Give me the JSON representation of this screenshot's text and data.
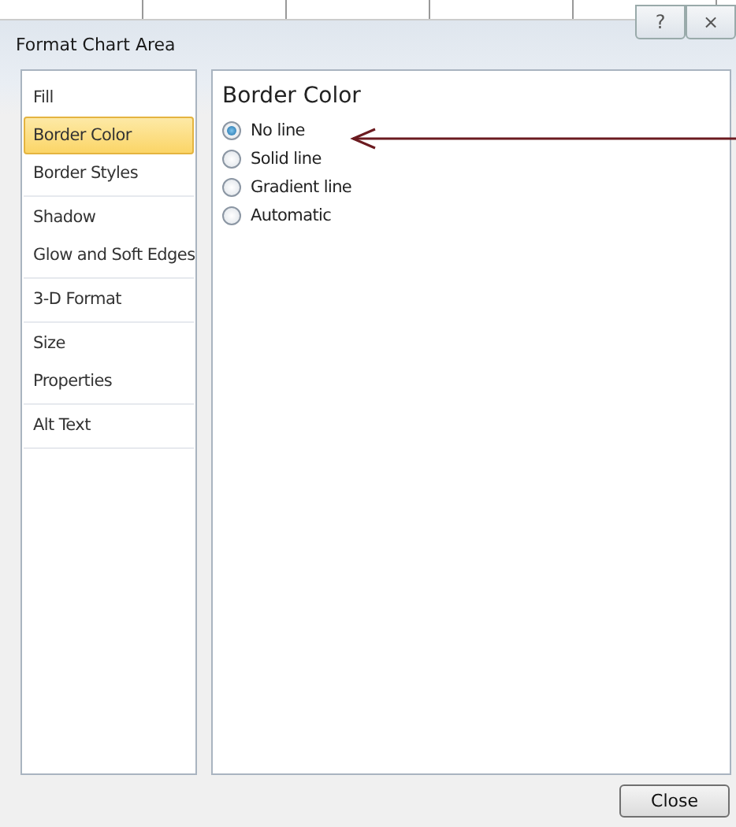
{
  "window": {
    "title": "Format Chart Area",
    "help_button": "?",
    "close_glyph": "×"
  },
  "sidebar": {
    "groups": [
      {
        "items": [
          {
            "label": "Fill",
            "selected": false
          },
          {
            "label": "Border Color",
            "selected": true
          },
          {
            "label": "Border Styles",
            "selected": false
          }
        ]
      },
      {
        "items": [
          {
            "label": "Shadow",
            "selected": false
          },
          {
            "label": "Glow and Soft Edges",
            "selected": false
          }
        ]
      },
      {
        "items": [
          {
            "label": "3-D Format",
            "selected": false
          }
        ]
      },
      {
        "items": [
          {
            "label": "Size",
            "selected": false
          },
          {
            "label": "Properties",
            "selected": false
          }
        ]
      },
      {
        "items": [
          {
            "label": "Alt Text",
            "selected": false
          }
        ]
      }
    ]
  },
  "panel": {
    "heading": "Border Color",
    "options": [
      {
        "label": "No line",
        "selected": true
      },
      {
        "label": "Solid line",
        "selected": false
      },
      {
        "label": "Gradient line",
        "selected": false
      },
      {
        "label": "Automatic",
        "selected": false
      }
    ]
  },
  "buttons": [
    {
      "label": "Close"
    }
  ]
}
